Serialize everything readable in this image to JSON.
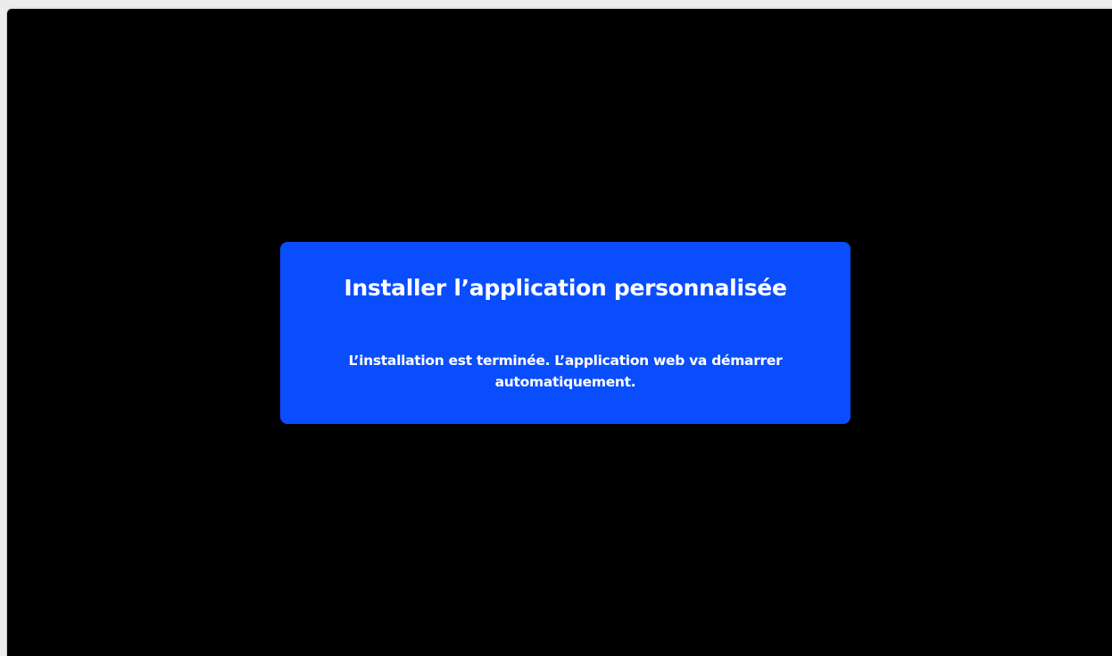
{
  "install_dialog": {
    "title": "Installer l’application personnalisée",
    "message": "L’installation est terminée. L’application web va démarrer automatiquement."
  },
  "colors": {
    "window_background": "#000000",
    "dialog_background": "#0a4dfc",
    "text": "#ffffff",
    "desktop": "#ececec"
  }
}
